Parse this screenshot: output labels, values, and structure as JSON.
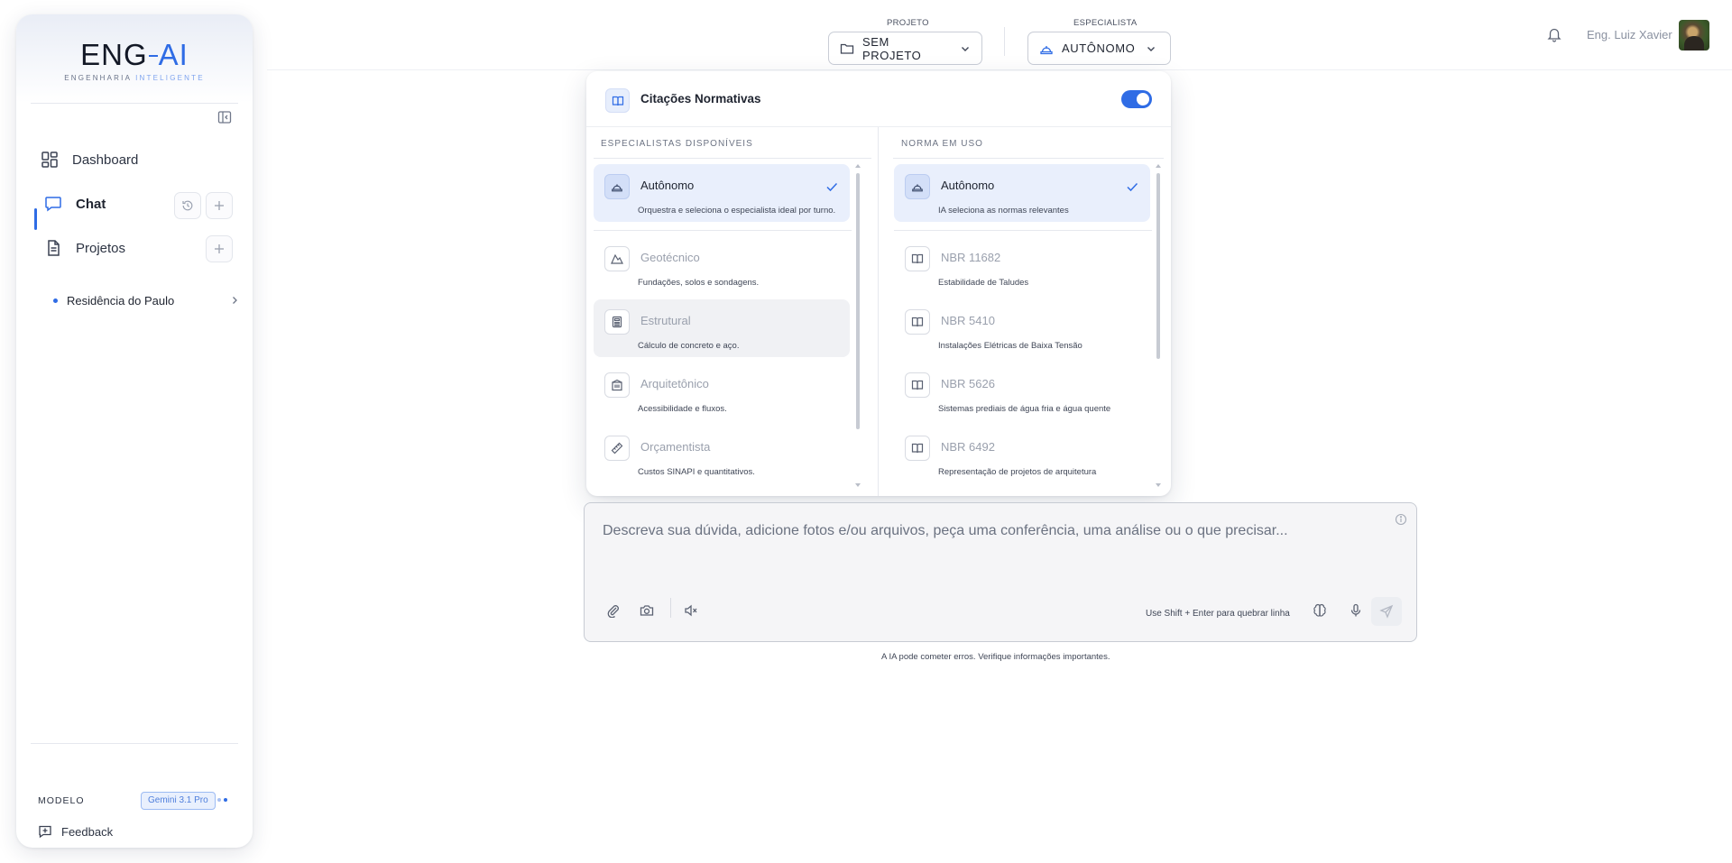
{
  "brand": {
    "logo_main": "ENG",
    "logo_ai": "AI",
    "logo_sub_1": "ENGENHARIA",
    "logo_sub_2": "INTELIGENTE"
  },
  "sidebar": {
    "nav": [
      {
        "label": "Dashboard",
        "icon": "dashboard-icon"
      },
      {
        "label": "Chat",
        "icon": "chat-icon"
      },
      {
        "label": "Projetos",
        "icon": "document-icon"
      }
    ],
    "projects": [
      {
        "label": "Residência do Paulo"
      }
    ],
    "model_label": "MODELO",
    "model_value": "Gemini 3.1 Pro",
    "feedback_label": "Feedback"
  },
  "topbar": {
    "project_label": "PROJETO",
    "project_value": "SEM PROJETO",
    "specialist_label": "ESPECIALISTA",
    "specialist_value": "AUTÔNOMO",
    "user_name": "Eng. Luiz Xavier"
  },
  "popover": {
    "title": "Citações Normativas",
    "toggle_on": true,
    "left_title": "ESPECIALISTAS DISPONÍVEIS",
    "right_title": "NORMA EM USO",
    "specialists": [
      {
        "name": "Autônomo",
        "desc": "Orquestra e seleciona o especialista ideal por turno.",
        "icon": "helmet-icon",
        "selected": true
      },
      {
        "name": "Geotécnico",
        "desc": "Fundações, solos e sondagens.",
        "icon": "mountain-icon",
        "selected": false
      },
      {
        "name": "Estrutural",
        "desc": "Cálculo de concreto e aço.",
        "icon": "calculator-icon",
        "selected": false
      },
      {
        "name": "Arquitetônico",
        "desc": "Acessibilidade e fluxos.",
        "icon": "building-icon",
        "selected": false
      },
      {
        "name": "Orçamentista",
        "desc": "Custos SINAPI e quantitativos.",
        "icon": "ruler-icon",
        "selected": false
      }
    ],
    "norms": [
      {
        "name": "Autônomo",
        "desc": "IA seleciona as normas relevantes",
        "icon": "helmet-icon",
        "selected": true
      },
      {
        "name": "NBR 11682",
        "desc": "Estabilidade de Taludes",
        "icon": "book-icon",
        "selected": false
      },
      {
        "name": "NBR 5410",
        "desc": "Instalações Elétricas de Baixa Tensão",
        "icon": "book-icon",
        "selected": false
      },
      {
        "name": "NBR 5626",
        "desc": "Sistemas prediais de água fria e água quente",
        "icon": "book-icon",
        "selected": false
      },
      {
        "name": "NBR 6492",
        "desc": "Representação de projetos de arquitetura",
        "icon": "book-icon",
        "selected": false
      }
    ]
  },
  "composer": {
    "placeholder": "Descreva sua dúvida, adicione fotos e/ou arquivos, peça uma conferência, uma análise ou o que precisar...",
    "hint": "Use Shift + Enter para quebrar linha",
    "disclaimer": "A IA pode cometer erros. Verifique informações importantes."
  },
  "colors": {
    "accent": "#2f6ce5",
    "selected_bg": "#e9effc"
  }
}
